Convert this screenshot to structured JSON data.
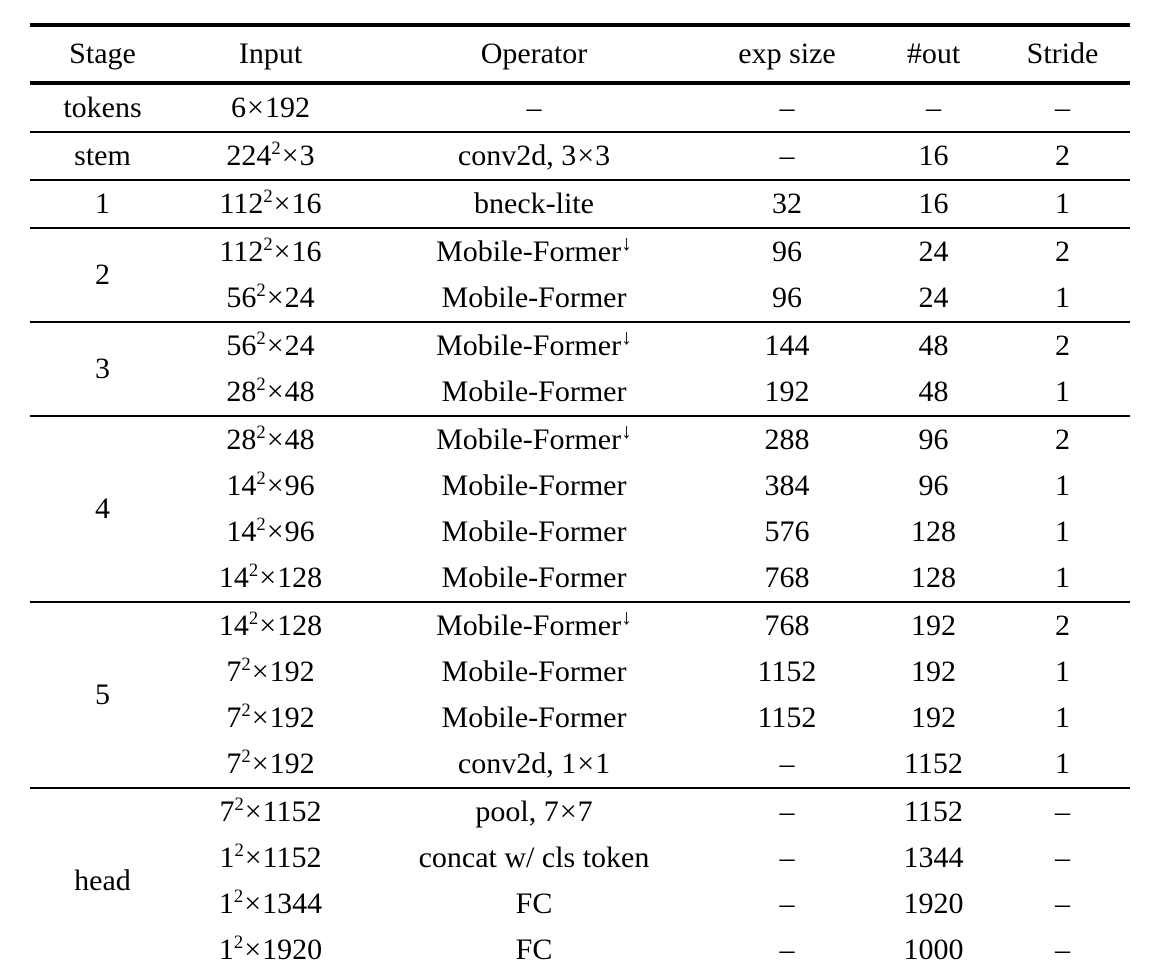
{
  "table": {
    "name": "mobile-former-architecture-spec",
    "columns": [
      "Stage",
      "Input",
      "Operator",
      "exp size",
      "#out",
      "Stride"
    ],
    "groups": [
      {
        "stage": "tokens",
        "rows": [
          {
            "input": "6×192",
            "operator": "–",
            "exp_size": "–",
            "out": "–",
            "stride": "–"
          }
        ]
      },
      {
        "stage": "stem",
        "rows": [
          {
            "input": "224²×3",
            "operator": "conv2d, 3×3",
            "exp_size": "–",
            "out": "16",
            "stride": "2"
          }
        ]
      },
      {
        "stage": "1",
        "rows": [
          {
            "input": "112²×16",
            "operator": "bneck-lite",
            "exp_size": "32",
            "out": "16",
            "stride": "1"
          }
        ]
      },
      {
        "stage": "2",
        "rows": [
          {
            "input": "112²×16",
            "operator": "Mobile-Former↓",
            "exp_size": "96",
            "out": "24",
            "stride": "2"
          },
          {
            "input": "56²×24",
            "operator": "Mobile-Former",
            "exp_size": "96",
            "out": "24",
            "stride": "1"
          }
        ]
      },
      {
        "stage": "3",
        "rows": [
          {
            "input": "56²×24",
            "operator": "Mobile-Former↓",
            "exp_size": "144",
            "out": "48",
            "stride": "2"
          },
          {
            "input": "28²×48",
            "operator": "Mobile-Former",
            "exp_size": "192",
            "out": "48",
            "stride": "1"
          }
        ]
      },
      {
        "stage": "4",
        "rows": [
          {
            "input": "28²×48",
            "operator": "Mobile-Former↓",
            "exp_size": "288",
            "out": "96",
            "stride": "2"
          },
          {
            "input": "14²×96",
            "operator": "Mobile-Former",
            "exp_size": "384",
            "out": "96",
            "stride": "1"
          },
          {
            "input": "14²×96",
            "operator": "Mobile-Former",
            "exp_size": "576",
            "out": "128",
            "stride": "1"
          },
          {
            "input": "14²×128",
            "operator": "Mobile-Former",
            "exp_size": "768",
            "out": "128",
            "stride": "1"
          }
        ]
      },
      {
        "stage": "5",
        "rows": [
          {
            "input": "14²×128",
            "operator": "Mobile-Former↓",
            "exp_size": "768",
            "out": "192",
            "stride": "2"
          },
          {
            "input": "7²×192",
            "operator": "Mobile-Former",
            "exp_size": "1152",
            "out": "192",
            "stride": "1"
          },
          {
            "input": "7²×192",
            "operator": "Mobile-Former",
            "exp_size": "1152",
            "out": "192",
            "stride": "1"
          },
          {
            "input": "7²×192",
            "operator": "conv2d, 1×1",
            "exp_size": "–",
            "out": "1152",
            "stride": "1"
          }
        ]
      },
      {
        "stage": "head",
        "rows": [
          {
            "input": "7²×1152",
            "operator": "pool, 7×7",
            "exp_size": "–",
            "out": "1152",
            "stride": "–"
          },
          {
            "input": "1²×1152",
            "operator": "concat w/ cls token",
            "exp_size": "–",
            "out": "1344",
            "stride": "–"
          },
          {
            "input": "1²×1344",
            "operator": "FC",
            "exp_size": "–",
            "out": "1920",
            "stride": "–"
          },
          {
            "input": "1²×1920",
            "operator": "FC",
            "exp_size": "–",
            "out": "1000",
            "stride": "–"
          }
        ]
      }
    ]
  }
}
